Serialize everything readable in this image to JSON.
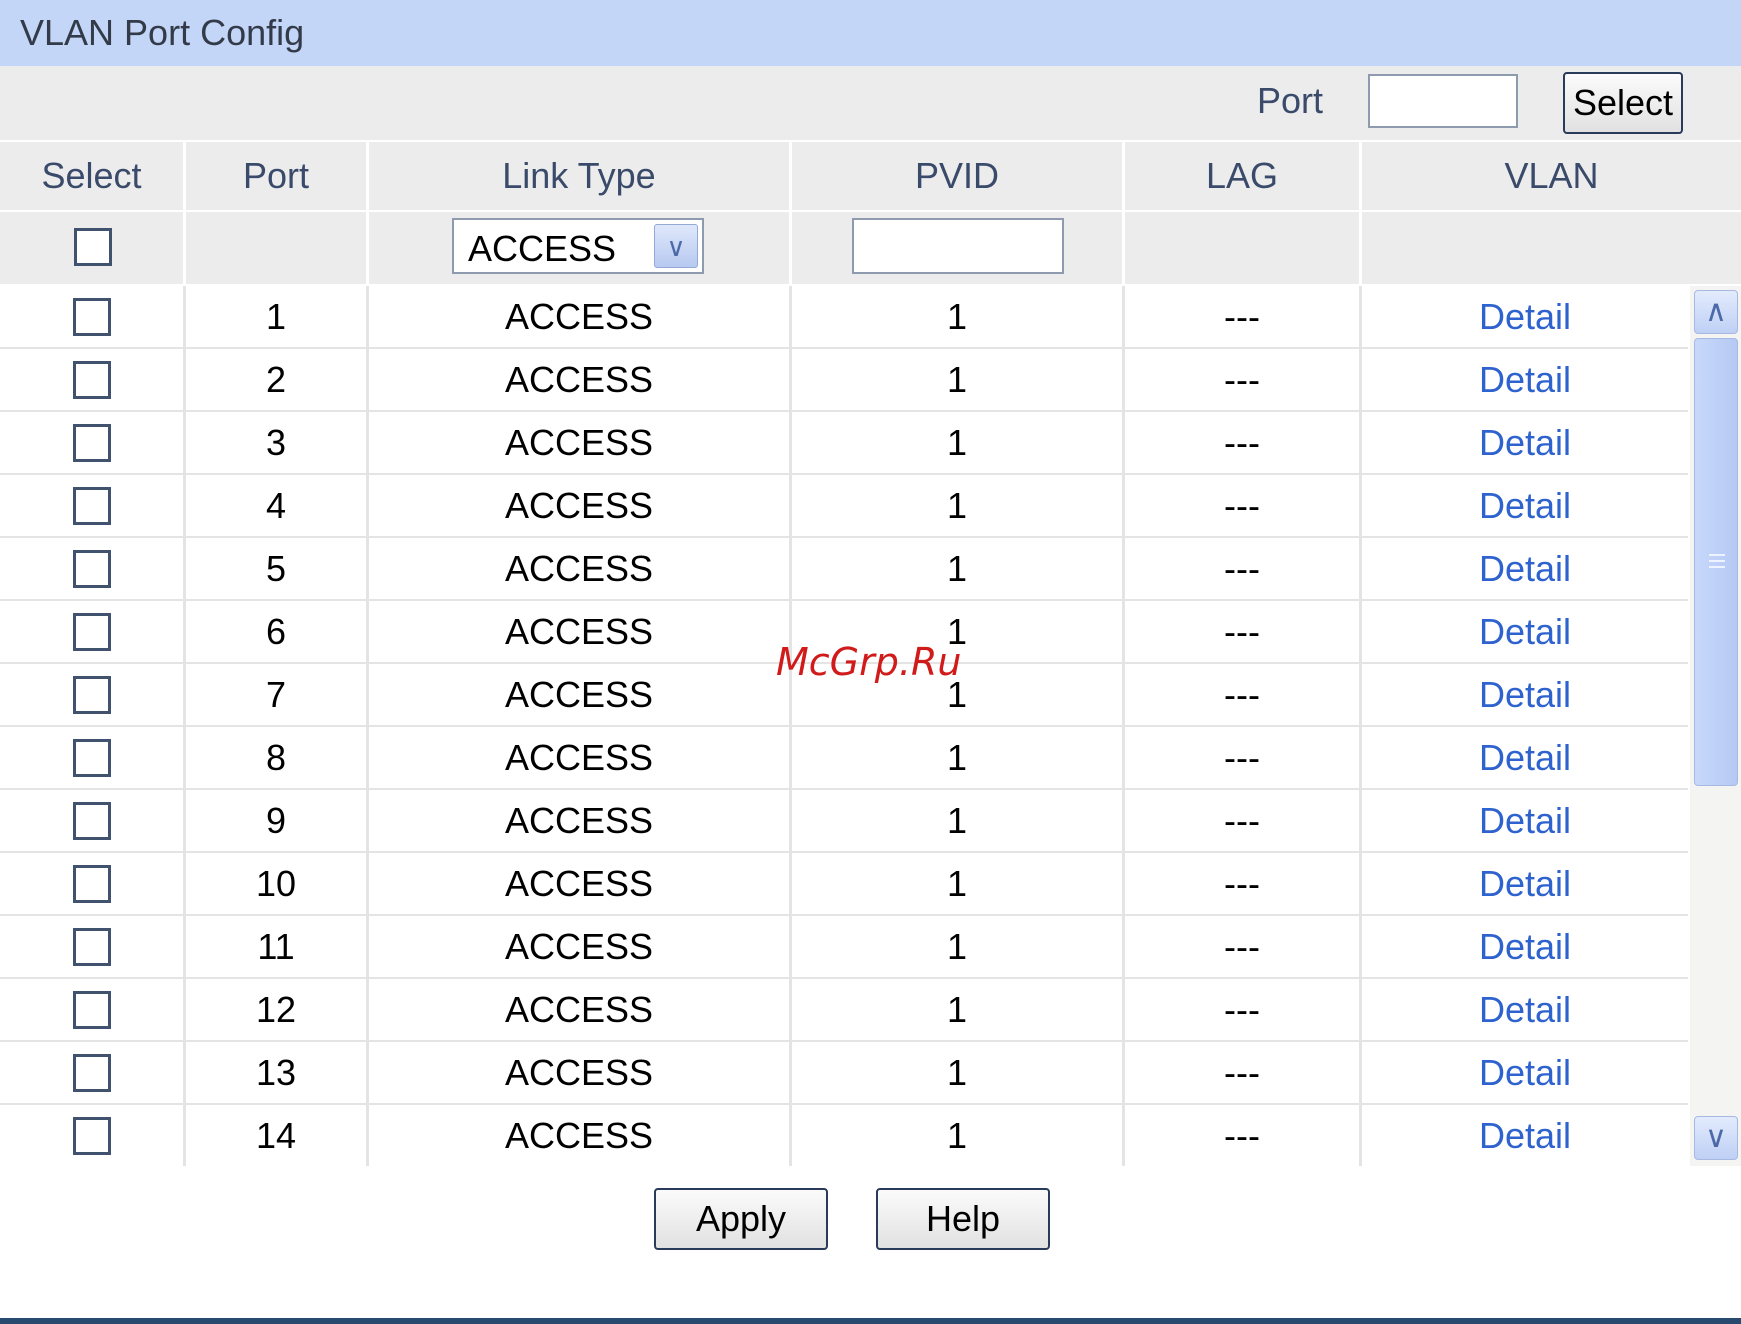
{
  "header": {
    "title": "VLAN Port Config"
  },
  "search": {
    "port_label": "Port",
    "port_value": "",
    "select_label": "Select"
  },
  "columns": [
    "Select",
    "Port",
    "Link Type",
    "PVID",
    "LAG",
    "VLAN"
  ],
  "filter": {
    "link_type": "ACCESS",
    "pvid_value": ""
  },
  "rows": [
    {
      "port": "1",
      "link_type": "ACCESS",
      "pvid": "1",
      "lag": "---",
      "vlan": "Detail"
    },
    {
      "port": "2",
      "link_type": "ACCESS",
      "pvid": "1",
      "lag": "---",
      "vlan": "Detail"
    },
    {
      "port": "3",
      "link_type": "ACCESS",
      "pvid": "1",
      "lag": "---",
      "vlan": "Detail"
    },
    {
      "port": "4",
      "link_type": "ACCESS",
      "pvid": "1",
      "lag": "---",
      "vlan": "Detail"
    },
    {
      "port": "5",
      "link_type": "ACCESS",
      "pvid": "1",
      "lag": "---",
      "vlan": "Detail"
    },
    {
      "port": "6",
      "link_type": "ACCESS",
      "pvid": "1",
      "lag": "---",
      "vlan": "Detail"
    },
    {
      "port": "7",
      "link_type": "ACCESS",
      "pvid": "1",
      "lag": "---",
      "vlan": "Detail"
    },
    {
      "port": "8",
      "link_type": "ACCESS",
      "pvid": "1",
      "lag": "---",
      "vlan": "Detail"
    },
    {
      "port": "9",
      "link_type": "ACCESS",
      "pvid": "1",
      "lag": "---",
      "vlan": "Detail"
    },
    {
      "port": "10",
      "link_type": "ACCESS",
      "pvid": "1",
      "lag": "---",
      "vlan": "Detail"
    },
    {
      "port": "11",
      "link_type": "ACCESS",
      "pvid": "1",
      "lag": "---",
      "vlan": "Detail"
    },
    {
      "port": "12",
      "link_type": "ACCESS",
      "pvid": "1",
      "lag": "---",
      "vlan": "Detail"
    },
    {
      "port": "13",
      "link_type": "ACCESS",
      "pvid": "1",
      "lag": "---",
      "vlan": "Detail"
    },
    {
      "port": "14",
      "link_type": "ACCESS",
      "pvid": "1",
      "lag": "---",
      "vlan": "Detail"
    }
  ],
  "actions": {
    "apply_label": "Apply",
    "help_label": "Help"
  },
  "watermark": "McGrp.Ru",
  "icons": {
    "dropdown": "chevron-down-icon",
    "scroll_up": "chevron-up-icon",
    "scroll_down": "chevron-down-icon"
  },
  "colors": {
    "header_bg": "#c3d6f8",
    "link": "#2e62ce",
    "table_bg": "#ececec",
    "bottom_bar": "#274a6e"
  }
}
